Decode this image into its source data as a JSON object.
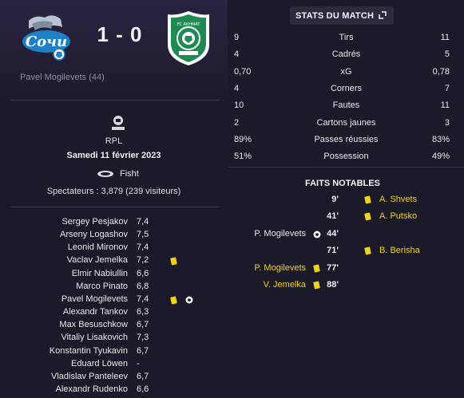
{
  "match": {
    "score": "1 - 0",
    "home_crest_text": "Сочи",
    "away_crest_text": "FC AKHMAT",
    "player_of_match": "Pavel Mogilevets (44)"
  },
  "info": {
    "league": "RPL",
    "date": "Samedi 11 février 2023",
    "venue": "Fisht",
    "attendance": "Spectateurs : 3,879 (239 visiteurs)"
  },
  "players": [
    {
      "name": "Sergey Pesjakov",
      "rating": "7,4"
    },
    {
      "name": "Arseny Logashov",
      "rating": "7,5"
    },
    {
      "name": "Leonid Mironov",
      "rating": "7,4"
    },
    {
      "name": "Vaclav Jemelka",
      "rating": "7,2",
      "yellow": true
    },
    {
      "name": "Elmir Nabiullin",
      "rating": "6,6"
    },
    {
      "name": "Marco Pinato",
      "rating": "6,8"
    },
    {
      "name": "Pavel Mogilevets",
      "rating": "7,4",
      "yellow": true,
      "goal": true
    },
    {
      "name": "Alexandr Tankov",
      "rating": "6,3"
    },
    {
      "name": "Max Besuschkow",
      "rating": "6,7"
    },
    {
      "name": "Vitaliy Lisakovich",
      "rating": "7,3"
    },
    {
      "name": "Konstantin Tyukavin",
      "rating": "6,7"
    },
    {
      "name": "Eduard Löwen",
      "rating": "-"
    },
    {
      "name": "Vladislav Panteleev",
      "rating": "6,7"
    },
    {
      "name": "Alexandr Rudenko",
      "rating": "6,6"
    }
  ],
  "stats": {
    "title": "STATS DU MATCH",
    "rows": [
      {
        "home": "9",
        "label": "Tirs",
        "away": "11"
      },
      {
        "home": "4",
        "label": "Cadrés",
        "away": "5"
      },
      {
        "home": "0,70",
        "label": "xG",
        "away": "0,78"
      },
      {
        "home": "4",
        "label": "Corners",
        "away": "7"
      },
      {
        "home": "10",
        "label": "Fautes",
        "away": "11"
      },
      {
        "home": "2",
        "label": "Cartons jaunes",
        "away": "3"
      },
      {
        "home": "89%",
        "label": "Passes réussies",
        "away": "83%"
      },
      {
        "home": "51%",
        "label": "Possession",
        "away": "49%"
      }
    ]
  },
  "events": {
    "title": "FAITS NOTABLES",
    "rows": [
      {
        "minute": "9'",
        "side": "away",
        "player": "A. Shvets",
        "type": "yellow"
      },
      {
        "minute": "41'",
        "side": "away",
        "player": "A. Putsko",
        "type": "yellow"
      },
      {
        "minute": "44'",
        "side": "home",
        "player": "P. Mogilevets",
        "type": "goal"
      },
      {
        "minute": "71'",
        "side": "away",
        "player": "B. Berisha",
        "type": "yellow"
      },
      {
        "minute": "77'",
        "side": "home",
        "player": "P. Mogilevets",
        "type": "yellow"
      },
      {
        "minute": "88'",
        "side": "home",
        "player": "V. Jemelka",
        "type": "yellow"
      }
    ]
  },
  "colors": {
    "background": "#1b1a28",
    "yellow_card": "#f0d21d",
    "away_green": "#1f8a52",
    "home_blue": "#1e7fc4"
  }
}
